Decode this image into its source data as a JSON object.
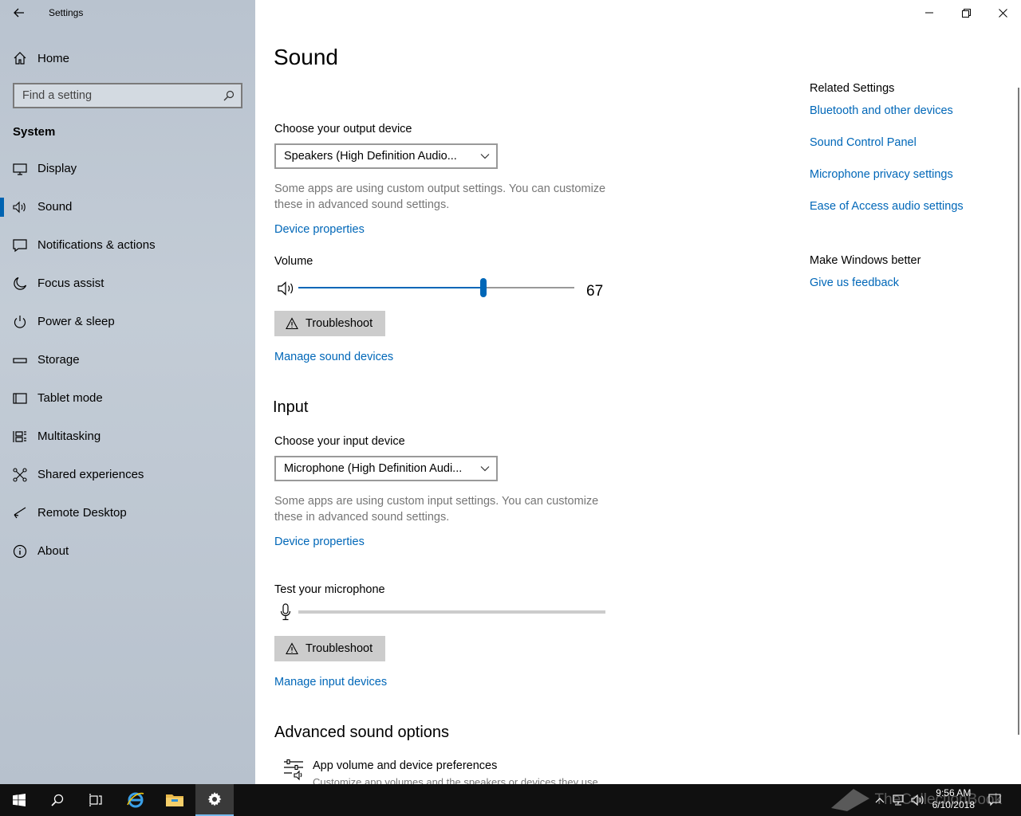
{
  "window": {
    "title": "Settings",
    "minimize": "minimize",
    "restore": "restore",
    "close": "close"
  },
  "sidebar": {
    "home_label": "Home",
    "search_placeholder": "Find a setting",
    "section_label": "System",
    "items": [
      {
        "label": "Display",
        "icon": "monitor-icon"
      },
      {
        "label": "Sound",
        "icon": "speaker-icon",
        "active": true
      },
      {
        "label": "Notifications & actions",
        "icon": "notifications-icon"
      },
      {
        "label": "Focus assist",
        "icon": "moon-icon"
      },
      {
        "label": "Power & sleep",
        "icon": "power-icon"
      },
      {
        "label": "Storage",
        "icon": "storage-icon"
      },
      {
        "label": "Tablet mode",
        "icon": "tablet-icon"
      },
      {
        "label": "Multitasking",
        "icon": "multitasking-icon"
      },
      {
        "label": "Shared experiences",
        "icon": "shared-experiences-icon"
      },
      {
        "label": "Remote Desktop",
        "icon": "remote-desktop-icon"
      },
      {
        "label": "About",
        "icon": "info-icon"
      }
    ]
  },
  "main": {
    "title": "Sound",
    "output": {
      "choose_label": "Choose your output device",
      "device": "Speakers (High Definition Audio...",
      "description": "Some apps are using custom output settings. You can customize these in advanced sound settings.",
      "device_properties": "Device properties",
      "volume_label": "Volume",
      "volume_value": "67",
      "volume_level": 67,
      "troubleshoot": "Troubleshoot",
      "manage": "Manage sound devices"
    },
    "input": {
      "heading": "Input",
      "choose_label": "Choose your input device",
      "device": "Microphone (High Definition Audi...",
      "description": "Some apps are using custom input settings. You can customize these in advanced sound settings.",
      "device_properties": "Device properties",
      "test_label": "Test your microphone",
      "mic_level": 0,
      "troubleshoot": "Troubleshoot",
      "manage": "Manage input devices"
    },
    "advanced": {
      "heading": "Advanced sound options",
      "item_title": "App volume and device preferences",
      "item_desc": "Customize app volumes and the speakers or devices they use."
    }
  },
  "related": {
    "heading": "Related Settings",
    "links": [
      "Bluetooth and other devices",
      "Sound Control Panel",
      "Microphone privacy settings",
      "Ease of Access audio settings"
    ],
    "feedback_heading": "Make Windows better",
    "feedback_link": "Give us feedback"
  },
  "taskbar": {
    "time": "9:56 AM",
    "date": "6/10/2018",
    "watermark": "TheCollectionBook"
  },
  "colors": {
    "accent": "#0067b8",
    "sidebar_bg": "#bfc8d3",
    "taskbar_bg": "#101010"
  }
}
